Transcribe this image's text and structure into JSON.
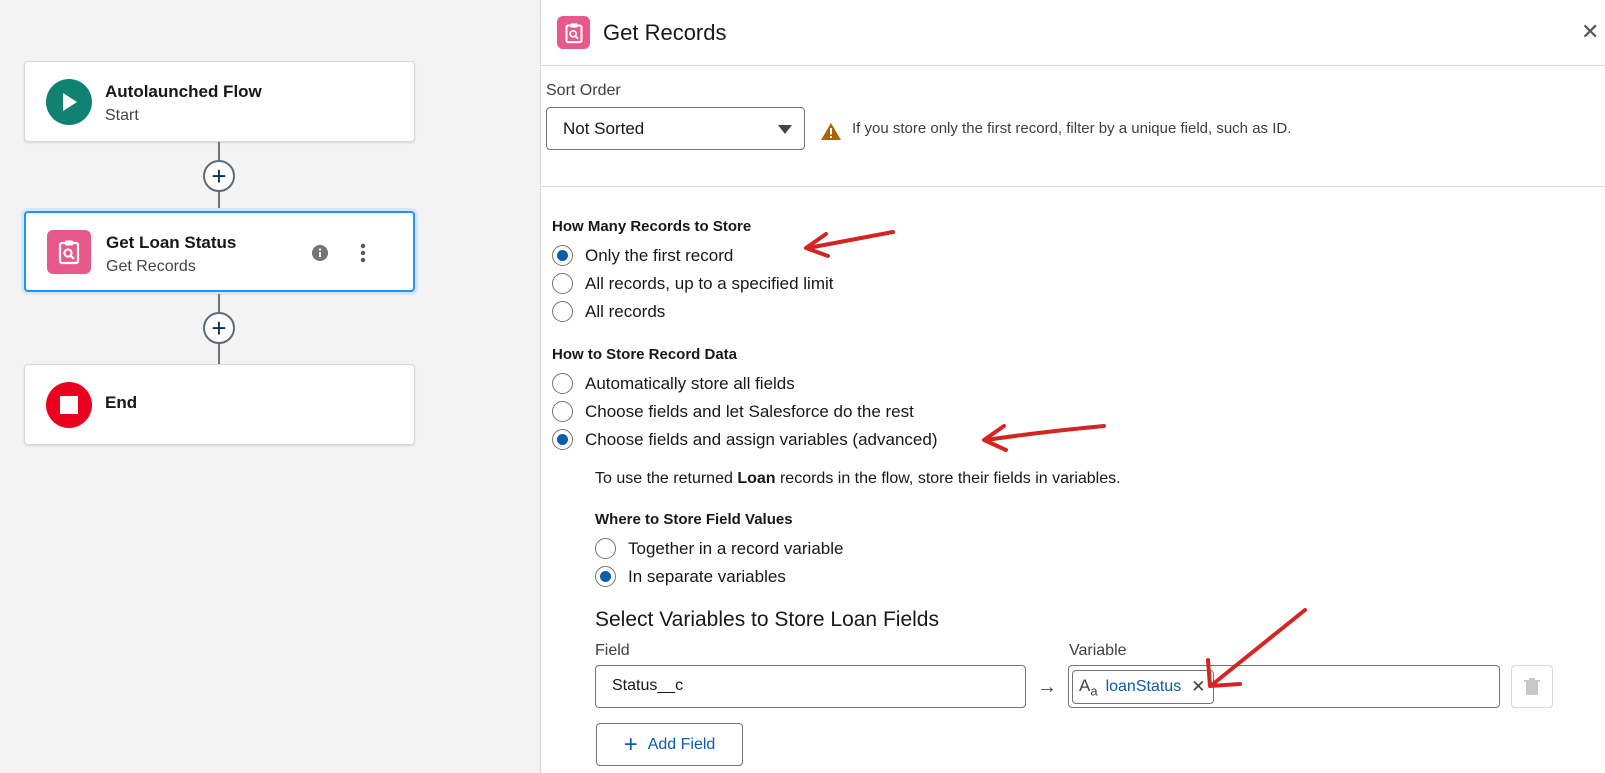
{
  "canvas": {
    "start_node": {
      "title": "Autolaunched Flow",
      "subtitle": "Start"
    },
    "get_node": {
      "title": "Get Loan Status",
      "subtitle": "Get Records"
    },
    "end_node": {
      "title": "End"
    },
    "add_element_label": "+"
  },
  "panel": {
    "title": "Get Records",
    "close_label": "✕",
    "sort": {
      "label": "Sort Order",
      "value": "Not Sorted",
      "warning": "If you store only the first record, filter by a unique field, such as ID."
    },
    "how_many": {
      "title": "How Many Records to Store",
      "options": [
        "Only the first record",
        "All records, up to a specified limit",
        "All records"
      ],
      "selected": 0
    },
    "how_store": {
      "title": "How to Store Record Data",
      "options": [
        "Automatically store all fields",
        "Choose fields and let Salesforce do the rest",
        "Choose fields and assign variables (advanced)"
      ],
      "selected": 2
    },
    "info": {
      "pre": "To use the returned ",
      "bold": "Loan",
      "post": " records in the flow, store their fields in variables."
    },
    "where": {
      "title": "Where to Store Field Values",
      "options": [
        "Together in a record variable",
        "In separate variables"
      ],
      "selected": 1
    },
    "variables": {
      "title": "Select Variables to Store Loan Fields",
      "field_label": "Field",
      "variable_label": "Variable",
      "field_value": "Status__c",
      "variable_value": "loanStatus",
      "arrow": "→",
      "add_field": "Add Field"
    }
  },
  "colors": {
    "accent": "#0b5cab",
    "start": "#0f8272",
    "get_records": "#e8598b",
    "end": "#ea001e",
    "annotation": "#d42424"
  }
}
